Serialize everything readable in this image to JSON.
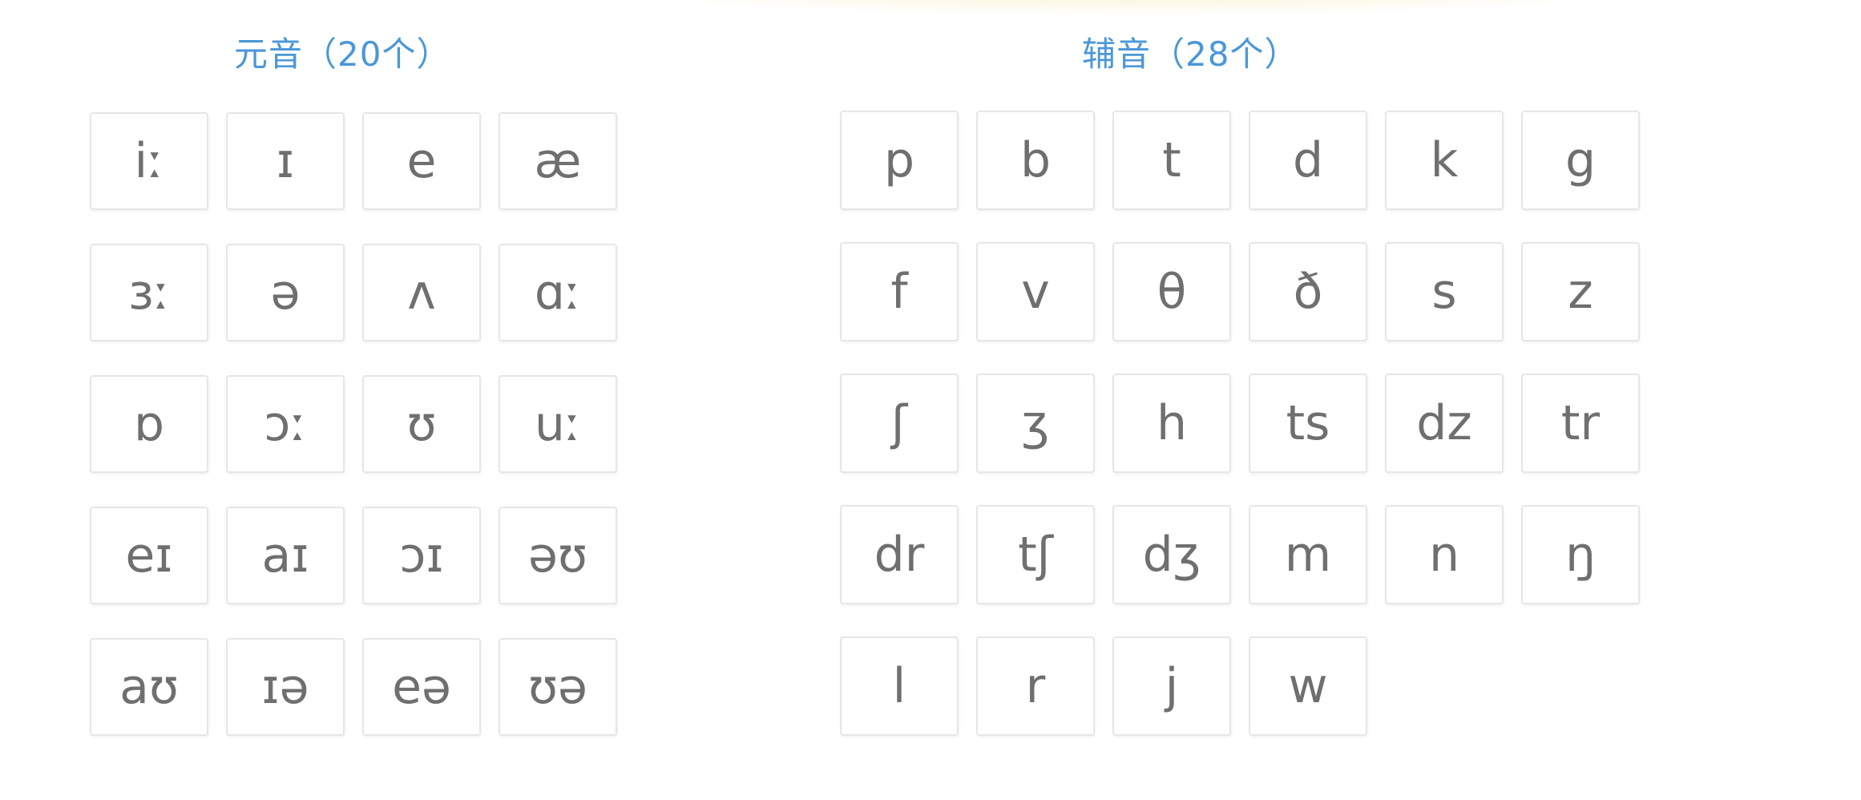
{
  "vowels": {
    "title": "元音（20个）",
    "symbols": [
      "iː",
      "ɪ",
      "e",
      "æ",
      "ɜː",
      "ə",
      "ʌ",
      "ɑː",
      "ɒ",
      "ɔː",
      "ʊ",
      "uː",
      "eɪ",
      "aɪ",
      "ɔɪ",
      "əʊ",
      "aʊ",
      "ɪə",
      "eə",
      "ʊə"
    ]
  },
  "consonants": {
    "title": "辅音（28个）",
    "symbols": [
      "p",
      "b",
      "t",
      "d",
      "k",
      "g",
      "f",
      "v",
      "θ",
      "ð",
      "s",
      "z",
      "ʃ",
      "ʒ",
      "h",
      "ts",
      "dz",
      "tr",
      "dr",
      "tʃ",
      "dʒ",
      "m",
      "n",
      "ŋ",
      "l",
      "r",
      "j",
      "w"
    ]
  }
}
